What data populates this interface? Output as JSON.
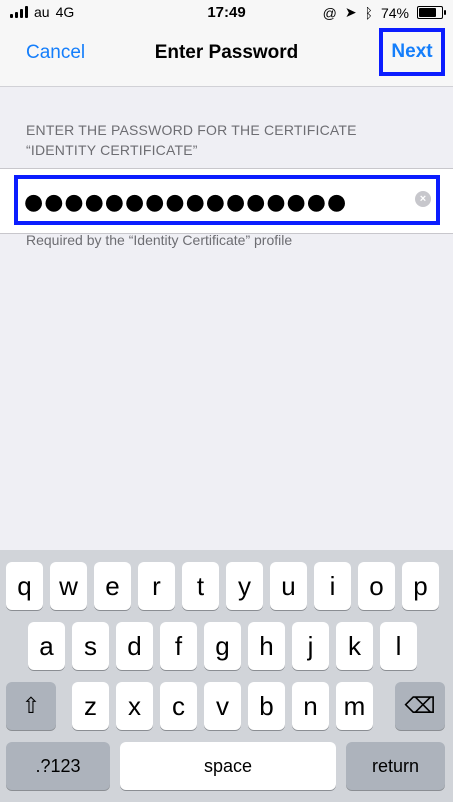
{
  "status": {
    "carrier": "au",
    "network": "4G",
    "time": "17:49",
    "battery": "74%"
  },
  "nav": {
    "cancel": "Cancel",
    "title": "Enter Password",
    "next": "Next"
  },
  "form": {
    "header_line1": "ENTER THE PASSWORD FOR THE CERTIFICATE",
    "header_line2": "“IDENTITY CERTIFICATE”",
    "password_value": "●●●●●●●●●●●●●●●●",
    "footer": "Required by the “Identity Certificate” profile"
  },
  "keyboard": {
    "row1": [
      "q",
      "w",
      "e",
      "r",
      "t",
      "y",
      "u",
      "i",
      "o",
      "p"
    ],
    "row2": [
      "a",
      "s",
      "d",
      "f",
      "g",
      "h",
      "j",
      "k",
      "l"
    ],
    "row3": [
      "z",
      "x",
      "c",
      "v",
      "b",
      "n",
      "m"
    ],
    "numbers": ".?123",
    "space": "space",
    "return": "return"
  },
  "icons": {
    "shift": "⇧",
    "delete": "⌫",
    "clear": "×"
  },
  "colors": {
    "accent": "#147efb",
    "highlight": "#0b1dff"
  }
}
